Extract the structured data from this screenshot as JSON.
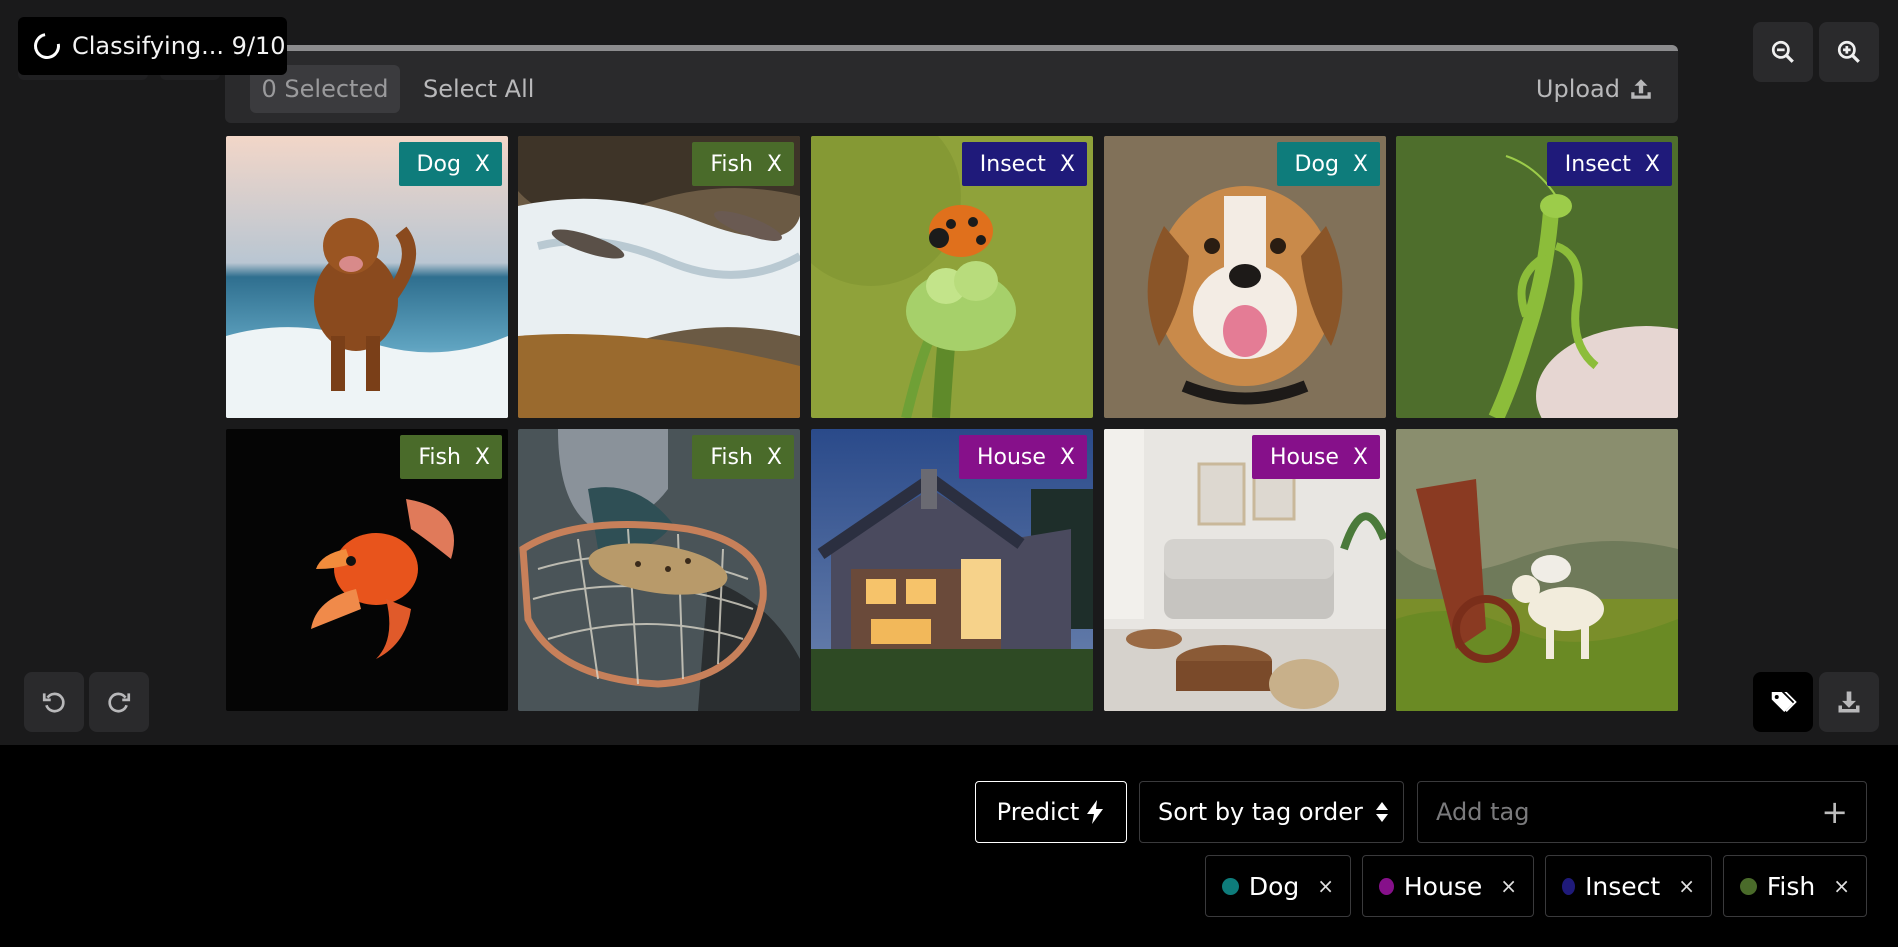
{
  "status": {
    "text": "Classifying... 9/10"
  },
  "toolbar": {
    "selected": "0 Selected",
    "select_all": "Select All",
    "upload": "Upload"
  },
  "colors": {
    "dog": "#0e7c7b",
    "fish": "#4a6b2a",
    "insect": "#1f1a7a",
    "house": "#86108a"
  },
  "images": [
    {
      "tag": "Dog",
      "remove": "X",
      "subject": "dog-running-on-beach"
    },
    {
      "tag": "Fish",
      "remove": "X",
      "subject": "salmon-jumping-rapids"
    },
    {
      "tag": "Insect",
      "remove": "X",
      "subject": "ladybug-on-plant"
    },
    {
      "tag": "Dog",
      "remove": "X",
      "subject": "beagle-portrait"
    },
    {
      "tag": "Insect",
      "remove": "X",
      "subject": "praying-mantis"
    },
    {
      "tag": "Fish",
      "remove": "X",
      "subject": "goldfish-black-background"
    },
    {
      "tag": "Fish",
      "remove": "X",
      "subject": "trout-in-net"
    },
    {
      "tag": "House",
      "remove": "X",
      "subject": "house-at-dusk"
    },
    {
      "tag": "House",
      "remove": "X",
      "subject": "living-room-interior"
    },
    {
      "tag": "",
      "remove": "",
      "subject": "cat-and-dog-at-farm-machinery"
    }
  ],
  "controls": {
    "undo_icon": "undo-icon",
    "redo_icon": "redo-icon",
    "zoom_out_icon": "zoom-out-icon",
    "zoom_in_icon": "zoom-in-icon",
    "tags_icon": "tags-icon",
    "download_icon": "download-icon"
  },
  "actions": {
    "predict": "Predict",
    "sort": "Sort by tag order",
    "add_tag_placeholder": "Add tag",
    "add_tag_icon": "+"
  },
  "tag_chips": [
    {
      "label": "Dog",
      "remove": "×"
    },
    {
      "label": "House",
      "remove": "×"
    },
    {
      "label": "Insect",
      "remove": "×"
    },
    {
      "label": "Fish",
      "remove": "×"
    }
  ]
}
